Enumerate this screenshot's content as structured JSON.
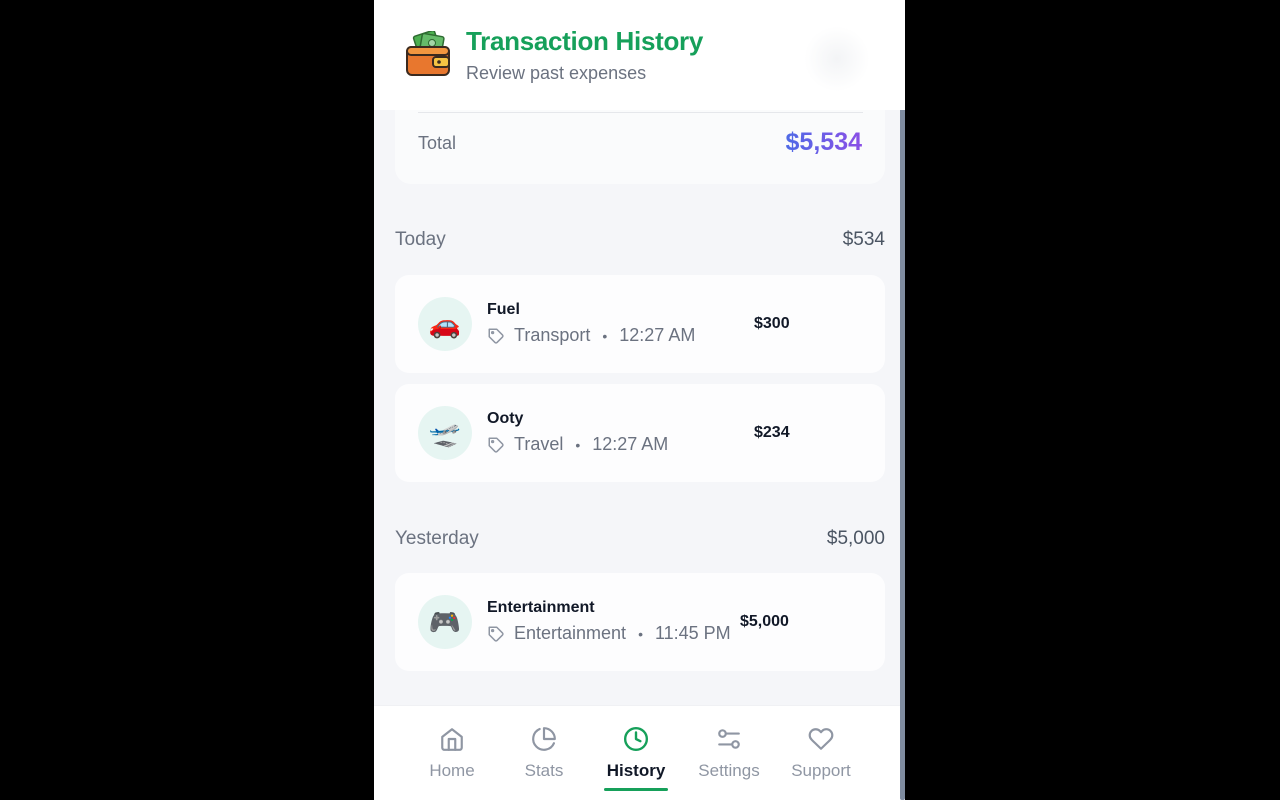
{
  "header": {
    "title": "Transaction History",
    "subtitle": "Review past expenses",
    "icon": "wallet-icon"
  },
  "summary": {
    "label": "Total",
    "value": "$5,534"
  },
  "groups": [
    {
      "label": "Today",
      "total": "$534",
      "items": [
        {
          "name": "Fuel",
          "category": "Transport",
          "time": "12:27 AM",
          "amount": "$300",
          "icon": "car-emoji",
          "emoji": "🚗"
        },
        {
          "name": "Ooty",
          "category": "Travel",
          "time": "12:27 AM",
          "amount": "$234",
          "icon": "airplane-emoji",
          "emoji": "🛫"
        }
      ]
    },
    {
      "label": "Yesterday",
      "total": "$5,000",
      "items": [
        {
          "name": "Entertainment",
          "category": "Entertainment",
          "time": "11:45 PM",
          "amount": "$5,000",
          "icon": "game-controller-emoji",
          "emoji": "🎮"
        }
      ]
    }
  ],
  "tabs": [
    {
      "label": "Home",
      "icon": "home-icon",
      "active": false
    },
    {
      "label": "Stats",
      "icon": "pie-chart-icon",
      "active": false
    },
    {
      "label": "History",
      "icon": "clock-icon",
      "active": true
    },
    {
      "label": "Settings",
      "icon": "sliders-icon",
      "active": false
    },
    {
      "label": "Support",
      "icon": "heart-icon",
      "active": false
    }
  ],
  "meta_separator": "•",
  "colors": {
    "accent": "#16a05a",
    "total_gradient_start": "#4f6ae6",
    "total_gradient_end": "#8b4fe6",
    "icon_bg": "#e6f5f2"
  }
}
